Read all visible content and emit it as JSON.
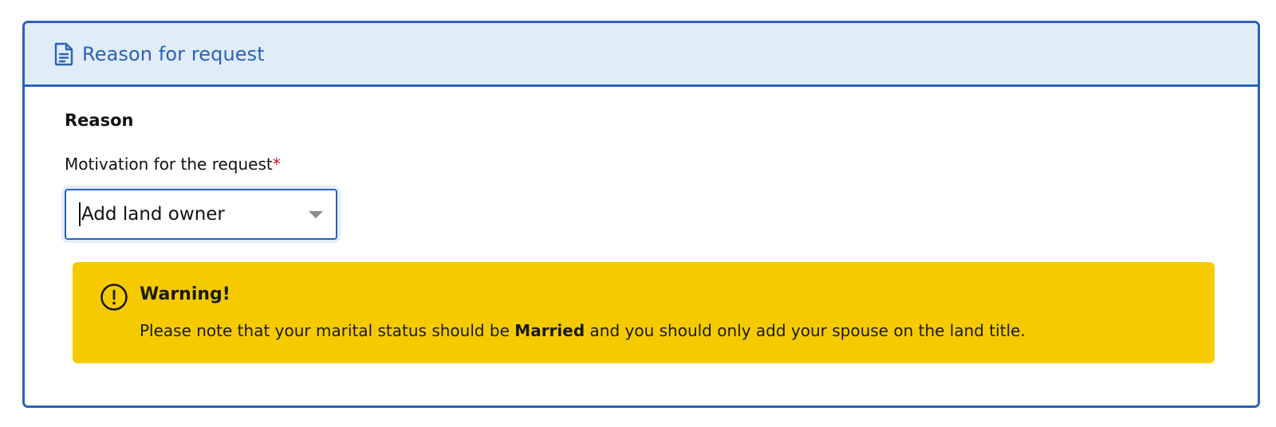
{
  "panel": {
    "header_icon": "document-icon",
    "title": "Reason for request"
  },
  "section": {
    "title": "Reason"
  },
  "field": {
    "label": "Motivation for the request",
    "required_mark": "*",
    "selected_value": "Add land owner",
    "arrow_icon": "chevron-down-icon"
  },
  "warning": {
    "icon": "exclamation-circle-icon",
    "title": "Warning!",
    "text_before": "Please note that your marital status should be ",
    "text_bold": "Married",
    "text_after": " and you should only add your spouse on the land title."
  },
  "colors": {
    "accent": "#2a62b9",
    "header_bg": "#e1ecf9",
    "warning_bg": "#f5cb00",
    "required": "#c8102e"
  }
}
